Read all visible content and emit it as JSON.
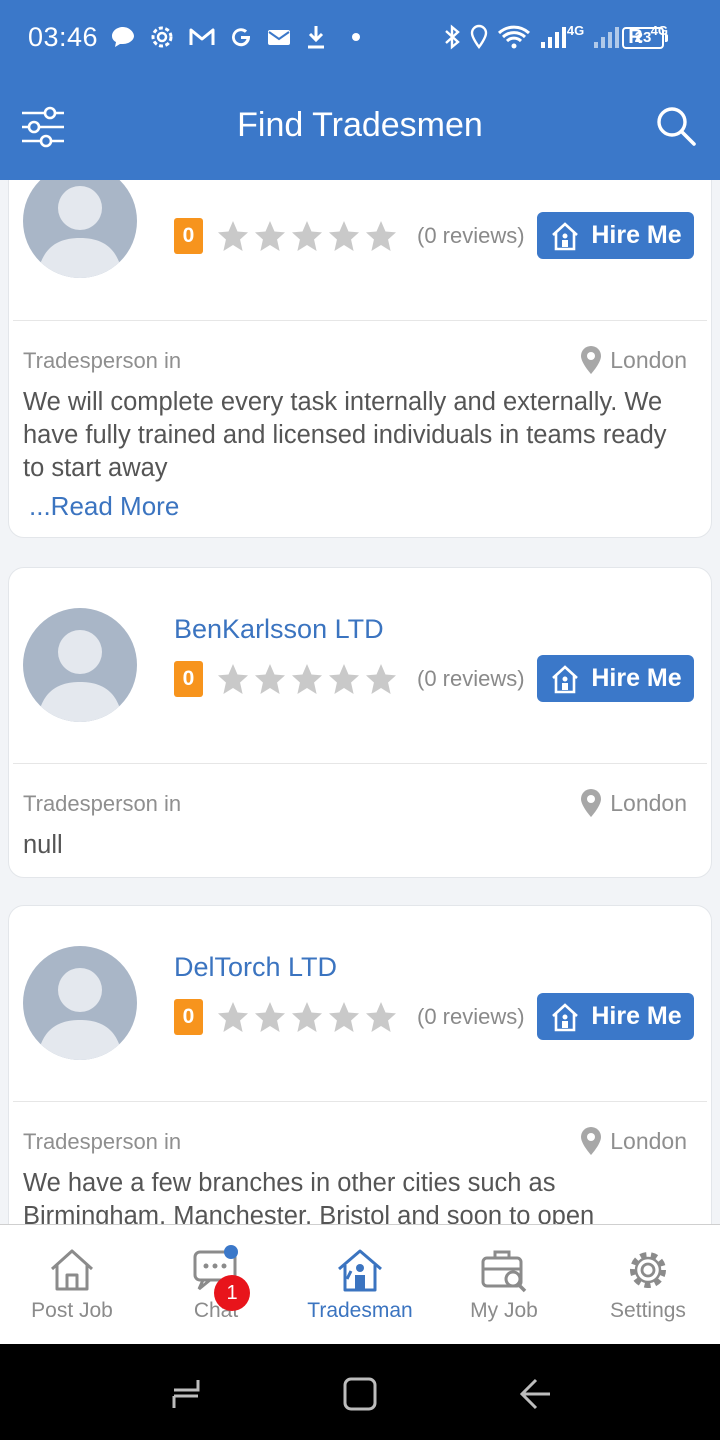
{
  "status_bar": {
    "time": "03:46",
    "battery": "23",
    "net_a": "4G",
    "net_b": "4G",
    "roaming": "R"
  },
  "app_bar": {
    "title": "Find Tradesmen"
  },
  "tradesmen": [
    {
      "name": "",
      "score": "0",
      "reviews": "(0 reviews)",
      "rating": 0,
      "hire_label": "Hire Me",
      "trade_label": "Tradesperson in",
      "location": "London",
      "description": "We will complete every task internally and externally. We have fully trained and licensed individuals in teams ready to start away",
      "read_more": "...Read More"
    },
    {
      "name": "BenKarlsson LTD",
      "score": "0",
      "reviews": "(0 reviews)",
      "rating": 0,
      "hire_label": "Hire Me",
      "trade_label": "Tradesperson in",
      "location": "London",
      "description": "null"
    },
    {
      "name": "DelTorch LTD",
      "score": "0",
      "reviews": "(0 reviews)",
      "rating": 0,
      "hire_label": "Hire Me",
      "trade_label": "Tradesperson in",
      "location": "London",
      "description": "We have a few branches in other cities such as Birmingham, Manchester, Bristol and soon to open"
    }
  ],
  "bottom_nav": {
    "items": [
      {
        "label": "Post Job",
        "icon": "home-icon"
      },
      {
        "label": "Chat",
        "icon": "chat-icon"
      },
      {
        "label": "Tradesman",
        "icon": "tradesman-house-icon"
      },
      {
        "label": "My Job",
        "icon": "briefcase-search-icon"
      },
      {
        "label": "Settings",
        "icon": "gear-icon"
      }
    ],
    "active": "Tradesman",
    "chat_badge": "1"
  },
  "colors": {
    "primary": "#3b78c9",
    "score_badge": "#f7941d",
    "notification": "#e8141b"
  }
}
